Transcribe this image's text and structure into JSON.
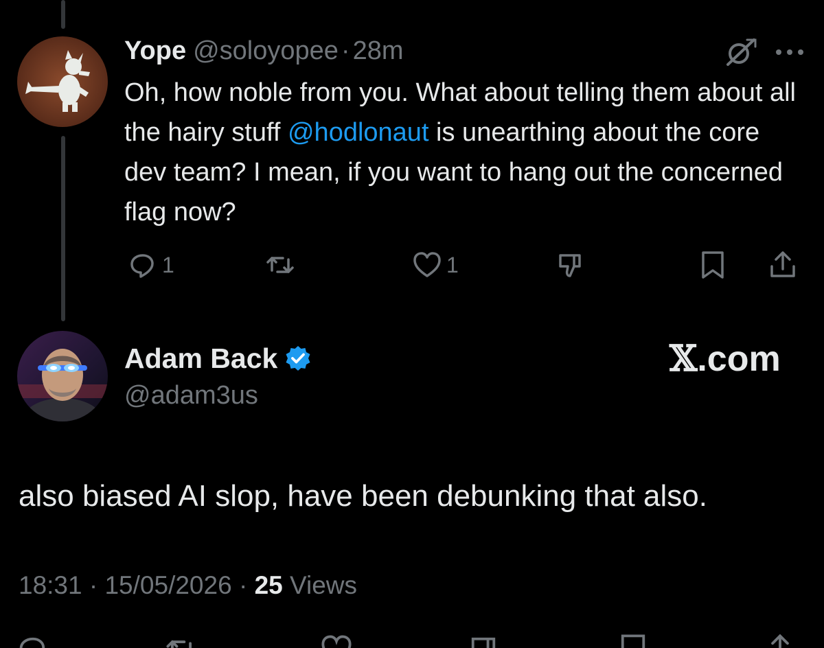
{
  "reply": {
    "name": "Yope",
    "handle": "@soloyopee",
    "separator": "·",
    "time": "28m",
    "text_before": "Oh, how noble from you. What about telling them about all the hairy stuff ",
    "mention": "@hodlonaut",
    "text_after": " is unearthing about the core dev team? I mean, if you want to hang out the concerned flag now?",
    "actions": {
      "reply_count": "1",
      "repost_count": "",
      "like_count": "1"
    }
  },
  "post": {
    "author_name": "Adam Back",
    "author_handle": "@adam3us",
    "brand_x": "𝕏",
    "brand_suffix": ".com",
    "text": "also biased AI slop, have been debunking that also.",
    "time": "18:31",
    "separator1": " · ",
    "date": "15/05/2026",
    "separator2": " · ",
    "views_count": "25",
    "views_label": " Views"
  },
  "colors": {
    "background": "#000000",
    "text": "#e7e9ea",
    "secondary": "#71767b",
    "accent": "#1d9bf0"
  },
  "icons": [
    "reply-icon",
    "repost-icon",
    "like-icon",
    "dislike-icon",
    "bookmark-icon",
    "share-icon",
    "grok-icon",
    "more-icon",
    "verified-badge-icon"
  ]
}
